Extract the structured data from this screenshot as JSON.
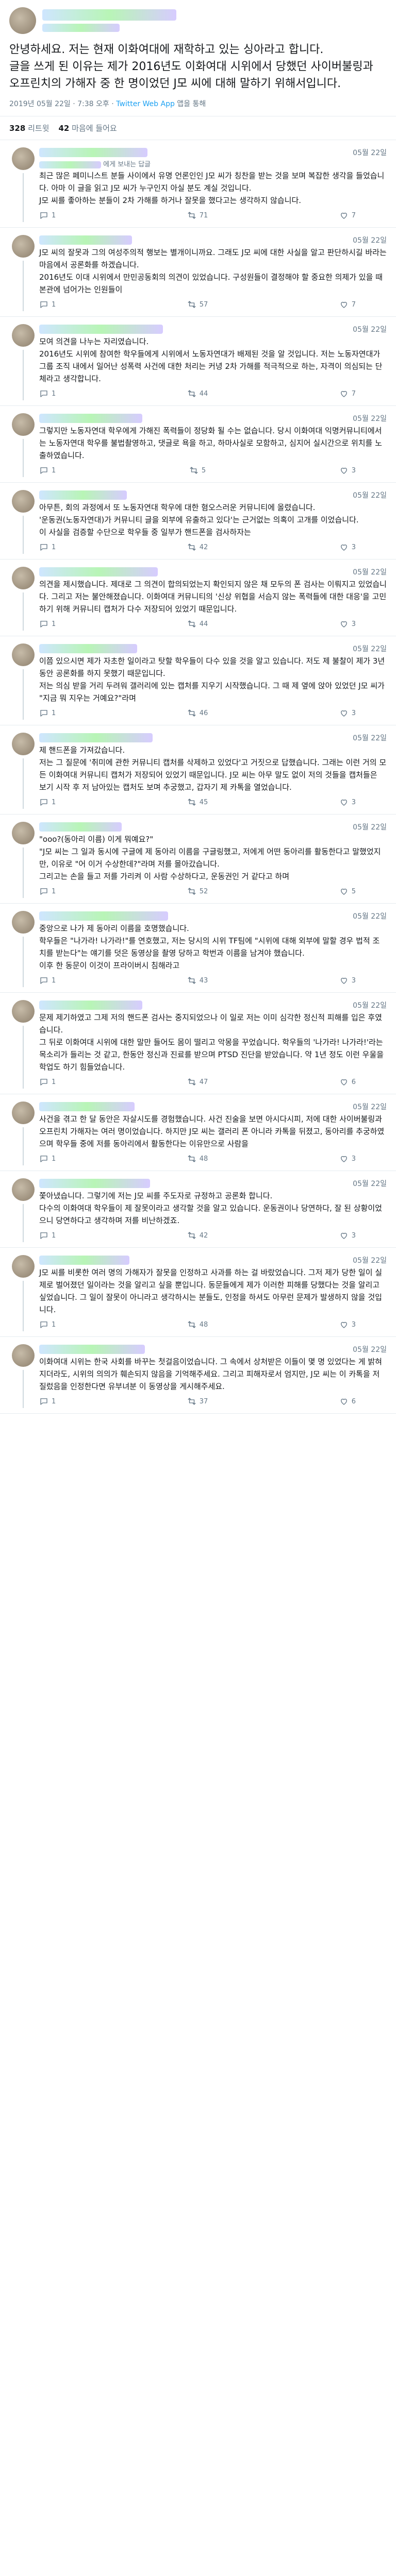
{
  "main_tweet": {
    "text": "안녕하세요. 저는 현재 이화여대에 재학하고 있는 싱아라고 합니다.\n글을 쓰게 된 이유는 제가 2016년도 이화여대 시위에서 당했던 사이버불링과 오프린치의 가해자 중 한 명이었던 J모 씨에 대해 말하기 위해서입니다.",
    "timestamp": "2019년 05월 22일 · 7:38 오후 · ",
    "source": "Twitter Web App",
    "source_suffix": " 앱을 통해"
  },
  "stats": {
    "retweets": "328",
    "retweets_label": "리트윗",
    "likes": "42",
    "likes_label": "마음에 들어요"
  },
  "replies": [
    {
      "date": "05월 22일",
      "reply_to": "에게 보내는 답글",
      "text": "최근 많은 페미니스트 분들 사이에서 유명 언론인인 J모 씨가 칭찬을 받는 것을 보며 복잡한 생각을 들었습니다. 아마 이 글을 읽고 J모 씨가 누구인지 아실 분도 계실 것입니다.\nJ모 씨를 좋아하는 분들이 2차 가해를 하거나 잘못을 했다고는 생각하지 않습니다.",
      "counts": [
        "1",
        "71",
        "7"
      ]
    },
    {
      "date": "05월 22일",
      "reply_to": "",
      "text": "J모 씨의 잘못과 그의 여성주의적 행보는 별개이니까요. 그래도 J모 씨에 대한 사실을 알고 판단하시길 바라는 마음에서 공론화를 하겠습니다.\n2016년도 이대 시위에서 만민공동회의 의견이 있었습니다. 구성원들이 결정해야 할 중요한 의제가 있을 때 본관에 넘어가는 인원들이",
      "counts": [
        "1",
        "57",
        "7"
      ]
    },
    {
      "date": "05월 22일",
      "reply_to": "",
      "text": "모여 의견을 나누는 자리였습니다.\n2016년도 시위에 참여한 학우들에게 시위에서 노동자연대가 배제된 것을 알 것입니다. 저는 노동자연대가 그룹 조직 내에서 일어난 성폭력 사건에 대한 처리는 커녕 2차 가해를 적극적으로 하는, 자격이 의심되는 단체라고 생각합니다.",
      "counts": [
        "1",
        "44",
        "7"
      ]
    },
    {
      "date": "05월 22일",
      "reply_to": "",
      "text": "그렇지만 노동자연대 학우에게 가해진 폭력들이 정당화 될 수는 없습니다. 당시 이화여대 익명커뮤니티에서 는 노동자연대 학우를 불법촬영하고, 댓글로 욕을 하고, 하마사실로 모함하고, 심지어 실시간으로 위치를 노출하였습니다.",
      "counts": [
        "1",
        "5",
        "3"
      ]
    },
    {
      "date": "05월 22일",
      "reply_to": "",
      "text": "아무튼, 회의 과정에서 또 노동자연대 학우에 대한 혐오스러운 커뮤니티에 올렸습니다.\n'운동권(노동자연대)가 커뮤니티 글을 외부에 유출하고 있다'는 근거없는 의혹이 고개를 이었습니다.\n이 사실을 검증할 수단으로 학우들 중 일부가 핸드폰을 검사하자는",
      "counts": [
        "1",
        "42",
        "3"
      ]
    },
    {
      "date": "05월 22일",
      "reply_to": "",
      "text": "의견을 제시했습니다. 제대로 그 의견이 합의되었는지 확인되지 않은 채 모두의 폰 검사는 이뤄지고 있었습니다. 그리고 저는 불안해졌습니다. 이화여대 커뮤니티의 '신상 위협을 서슴지 않는 폭력들에 대한 대응'을 고민하기 위해 커뮤니티 캡처가 다수 저장되어 있었기 때문입니다.",
      "counts": [
        "1",
        "44",
        "3"
      ]
    },
    {
      "date": "05월 22일",
      "reply_to": "",
      "text": "이쯤 있으시면 제가 자초한 일이라고 탓할 학우들이 다수 있을 것을 알고 있습니다. 저도 제 불찰이 제가 3년 동안 공론화를 하지 못했기 때문입니다.\n저는 의심 받을 거리 두려워 갤러리에 있는 캡처를 지우기 시작했습니다. 그 때 제 옆에 앉아 있었던 J모 씨가 \"지금 뭐 지우는 거예요?\"라며",
      "counts": [
        "1",
        "46",
        "3"
      ]
    },
    {
      "date": "05월 22일",
      "reply_to": "",
      "text": "제 핸드폰을 가져갔습니다.\n저는 그 질문에 '취미에 관한 커뮤니티 캡처를 삭제하고 있었다'고 거짓으로 답했습니다. 그래는 이런 거의 모든 이화여대 커뮤니티 캡처가 저장되어 있었기 때문입니다. J모 씨는 아무 말도 없이 저의 것들을 캡처들은 보기 시작 후 저 남아있는 캡처도 보며 추궁했고, 갑자기 제 카톡을 열었습니다.",
      "counts": [
        "1",
        "45",
        "3"
      ]
    },
    {
      "date": "05월 22일",
      "reply_to": "",
      "text": "\"ooo?(동아리 이름) 이게 뭐예요?\"\n\"J모 씨는 그 일과 동시에 구글에 제 동아리 이름을 구글링했고, 저에게 어떤 동아리를 활동한다고 말했었지만, 이유로 \"어 이거 수상한데?\"라며 저를 몰아갔습니다.\n그리고는 손을 들고 저를 가리켜 이 사람 수상하다고, 운동권인 거 같다고 하며",
      "counts": [
        "1",
        "52",
        "5"
      ]
    },
    {
      "date": "05월 22일",
      "reply_to": "",
      "text": "중앙으로 나가 제 동아리 이름을 호명했습니다.\n학우들은 \"나가라! 나가라!\"를 연호했고, 저는 당시의 시위 TF팀에 \"시위에 대해 외부에 말할 경우 법적 조치를 받는다\"는 얘기를 덧은 동영상을 촬영 당하고 학번과 이름을 남겨야 했습니다.\n이후 한 동문이 이것이 프라이버시 침해라고",
      "counts": [
        "1",
        "43",
        "3"
      ]
    },
    {
      "date": "05월 22일",
      "reply_to": "",
      "text": "문제 제기하였고 그제 저의 핸드폰 검사는 중지되었으나 이 일로 저는 이미 심각한 정신적 피해를 입은 후였습니다.\n그 뒤로 이화여대 시위에 대한 말만 들어도 몸이 떨리고 악몽을 꾸었습니다. 학우들의 '나가라! 나가라!'라는 목소리가 들리는 것 같고, 한동안 정신과 진료를 받으며 PTSD 진단을 받았습니다. 약 1년 정도 이런 우울을 학업도 하기 힘들었습니다.",
      "counts": [
        "1",
        "47",
        "6"
      ]
    },
    {
      "date": "05월 22일",
      "reply_to": "",
      "text": "사건을 겪고 한 달 동안은 자살시도를 경험했습니다. 사건 진술을 보면 아시다시피, 저에 대한 사이버불링과 오프린치 가해자는 여러 명이었습니다. 하지만 J모 씨는 갤러리 폰 아니라 카톡을 뒤졌고, 동아리를 추궁하였으며 학우들 중에 저를 동아리에서 활동한다는 이유만으로 사람을",
      "counts": [
        "1",
        "48",
        "3"
      ]
    },
    {
      "date": "05월 22일",
      "reply_to": "",
      "text": "쫓아냈습니다. 그렇기에 저는 J모 씨를 주도자로 규정하고 공론화 합니다.\n다수의 이화여대 학우들이 제 잘못이라고 생각할 것을 알고 있습니다. 운동권이나 당연하다, 잘 된 상황이었으니 당연하다고 생각하며 저를 비난하겠죠.",
      "counts": [
        "1",
        "42",
        "3"
      ]
    },
    {
      "date": "05월 22일",
      "reply_to": "",
      "text": "J모 씨를 비롯한 여러 명의 가해자가 잘못을 인정하고 사과를 하는 걸 바랐었습니다. 그저 제가 당한 일이 실제로 벌어졌던 일이라는 것을 알리고 싶을 뿐입니다. 동문들에게 제가 이러한 피해를 당했다는 것을 알리고 싶었습니다. 그 일이 잘못이 아니라고 생각하시는 분들도, 인정을 하셔도 아무런 문제가 발생하지 않을 것입니다.",
      "counts": [
        "1",
        "48",
        "3"
      ]
    },
    {
      "date": "05월 22일",
      "reply_to": "",
      "text": "이화여대 시위는 한국 사회를 바꾸는 첫걸음이었습니다. 그 속에서 상처받은 이들이 몇 명 있었다는 게 밝혀지더라도, 시위의 의의가 훼손되지 않음을 기억해주세요. 그리고 피해자로서 엄지만, J모 씨는 이 카톡을 저질렀음을 인정한다면 유부녀분 이 동영상을 게시해주세요.",
      "counts": [
        "1",
        "37",
        "6"
      ]
    }
  ],
  "icons": [
    "avatar",
    "reply-icon",
    "retweet-icon",
    "like-icon"
  ],
  "colors": {
    "accent": "#1da1f2",
    "meta": "#657786",
    "divider": "#e6ecf0"
  }
}
